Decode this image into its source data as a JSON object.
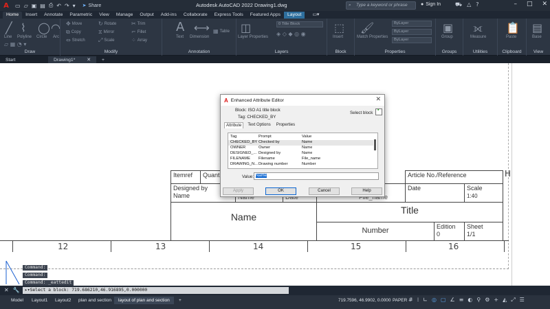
{
  "app": {
    "title": "Autodesk AutoCAD 2022   Drawing1.dwg",
    "share_label": "Share",
    "search_placeholder": "Type a keyword or phrase",
    "signin_label": "Sign In"
  },
  "ribbon_tabs": [
    "Home",
    "Insert",
    "Annotate",
    "Parametric",
    "View",
    "Manage",
    "Output",
    "Add-ins",
    "Collaborate",
    "Express Tools",
    "Featured Apps",
    "Layout"
  ],
  "panels": {
    "draw": {
      "title": "Draw",
      "items": [
        "Line",
        "Polyline",
        "Circle",
        "Arc"
      ]
    },
    "modify": {
      "title": "Modify",
      "items": [
        "Move",
        "Rotate",
        "Trim",
        "Copy",
        "Mirror",
        "Fillet",
        "Stretch",
        "Scale",
        "Array"
      ]
    },
    "annotation": {
      "title": "Annotation",
      "items": [
        "Text",
        "Dimension",
        "Table"
      ]
    },
    "layers": {
      "title": "Layers",
      "items": [
        "Layer Properties"
      ],
      "combo": "0 Title Block"
    },
    "block": {
      "title": "Block",
      "items": [
        "Insert"
      ]
    },
    "properties": {
      "title": "Properties",
      "items": [
        "Match Properties"
      ],
      "combo1": "ByLayer",
      "combo2": "ByLayer",
      "combo3": "ByLayer"
    },
    "groups": {
      "title": "Groups",
      "items": [
        "Group"
      ]
    },
    "utilities": {
      "title": "Utilities",
      "items": [
        "Measure"
      ]
    },
    "clipboard": {
      "title": "Clipboard",
      "items": [
        "Paste"
      ]
    },
    "view": {
      "title": "View",
      "items": [
        "Base"
      ]
    }
  },
  "doc_tabs": {
    "start": "Start",
    "active": "Drawing1*"
  },
  "titleblock": {
    "itemref": "Itemref",
    "quant": "Quant",
    "designed_by": "Designed by",
    "name_small": "Name",
    "name_big": "Name",
    "article": "Article No./Reference",
    "date": "Date",
    "scale": "Scale",
    "scale_val": "1:40",
    "title": "Title",
    "number": "Number",
    "edition": "Edition",
    "edition_val": "0",
    "sheet": "Sheet",
    "sheet_val": "1/1",
    "frag_name": "Name",
    "frag_date": "Date",
    "frag_file": "File_name",
    "side_h": "H"
  },
  "ruler": [
    "12",
    "13",
    "14",
    "15",
    "16"
  ],
  "command_history": [
    "Command:",
    "Command:",
    "Command: _eattedit"
  ],
  "dialog": {
    "title": "Enhanced Attribute Editor",
    "block_label": "Block: ISO A1 title block",
    "tag_label": "Tag: CHECKED_BY",
    "select_block": "Select block",
    "tabs": [
      "Attribute",
      "Text Options",
      "Properties"
    ],
    "headers": [
      "Tag",
      "Prompt",
      "Value"
    ],
    "rows": [
      [
        "CHECKED_BY",
        "Checked by",
        "Name"
      ],
      [
        "OWNER",
        "Owner",
        "Name"
      ],
      [
        "DESIGNED_...",
        "Designed by",
        "Name"
      ],
      [
        "FILENAME",
        "Filename",
        "File_name"
      ],
      [
        "DRAWING_N...",
        "Drawing number",
        "Number"
      ]
    ],
    "value_label": "Value:",
    "value": "Name",
    "buttons": [
      "Apply",
      "OK",
      "Cancel",
      "Help"
    ]
  },
  "command_line": "Select a block: 719.686210,46.916895,0.000000",
  "layout_tabs": [
    "Model",
    "Layout1",
    "Layout2",
    "plan and section",
    "layout of plan and section"
  ],
  "status": {
    "coords": "719.7596, 46.9902, 0.0000",
    "paper": "PAPER"
  }
}
